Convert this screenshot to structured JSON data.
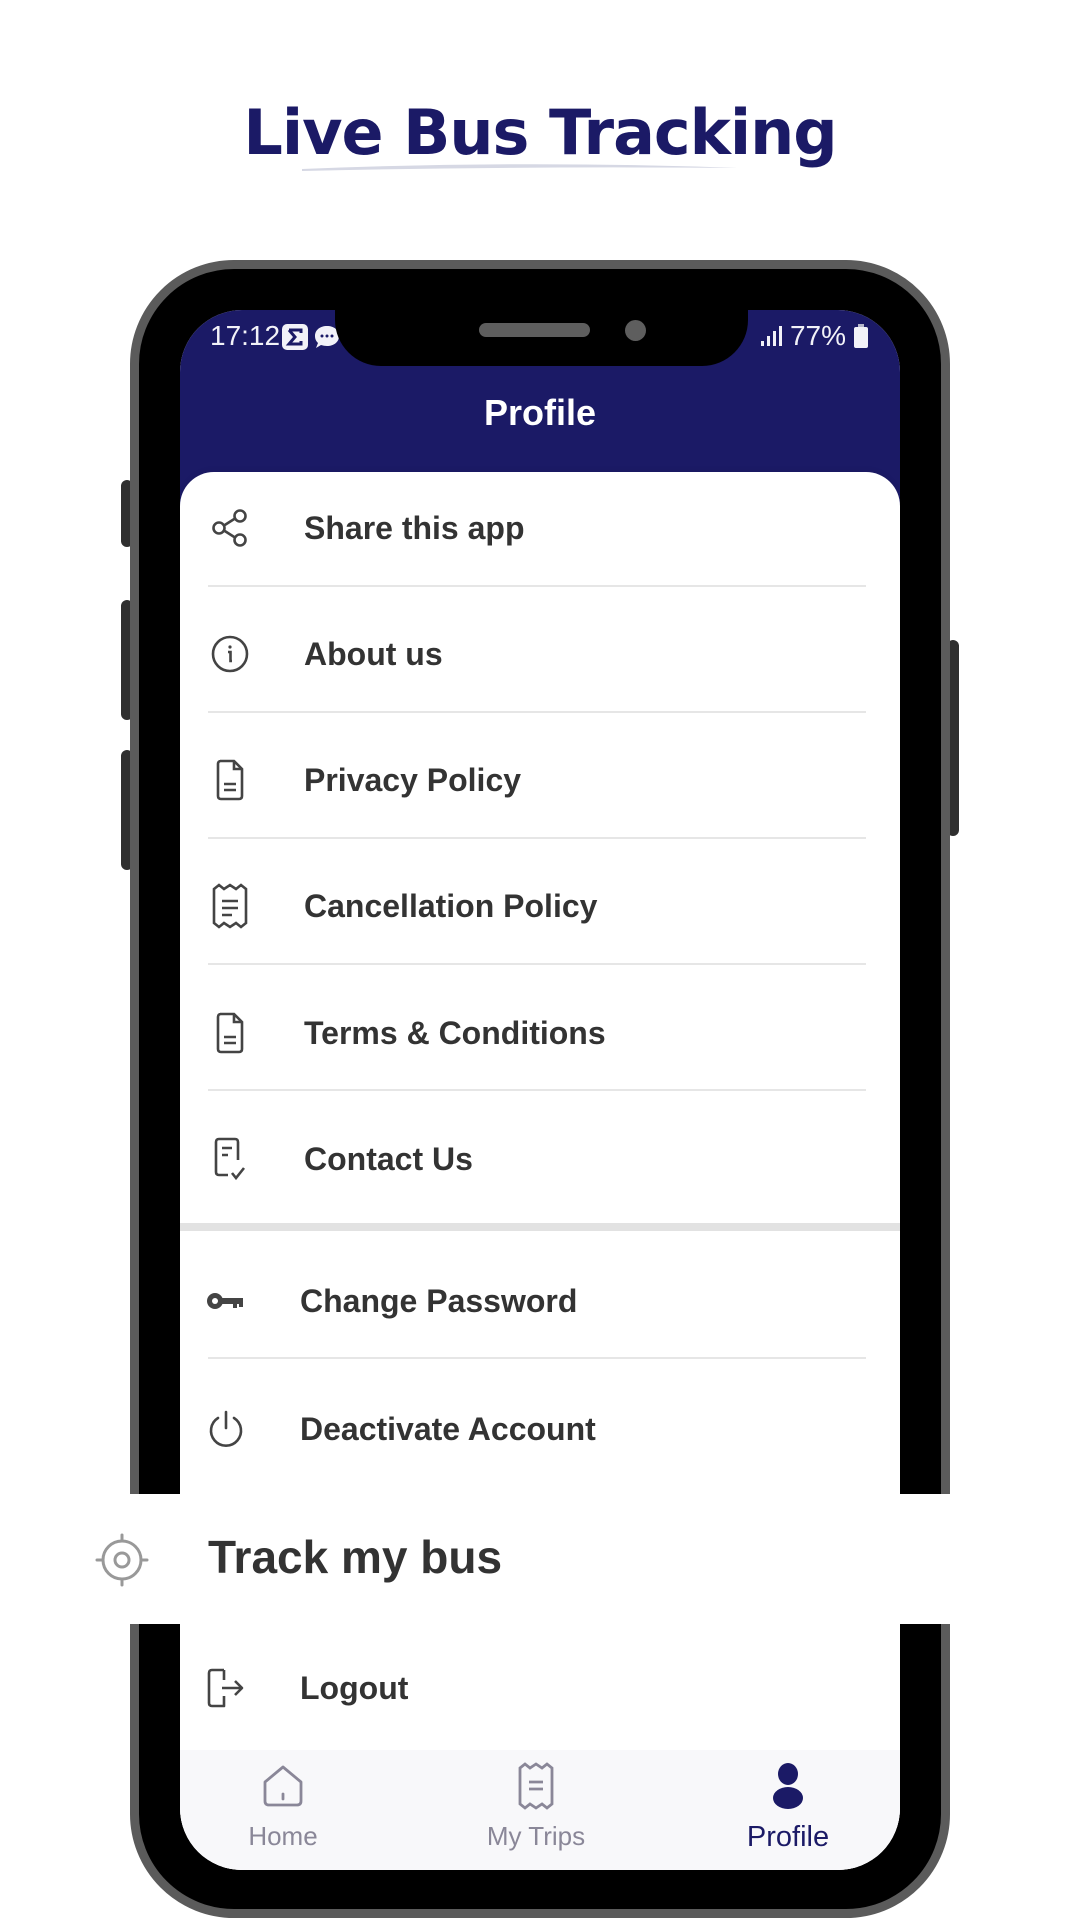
{
  "promo": {
    "title": "Live Bus Tracking"
  },
  "status_bar": {
    "time": "17:12",
    "battery": "77%"
  },
  "header": {
    "title": "Profile"
  },
  "menu": {
    "items": [
      {
        "label": "Share this app",
        "icon": "share-icon"
      },
      {
        "label": "About us",
        "icon": "info-icon"
      },
      {
        "label": "Privacy Policy",
        "icon": "document-icon"
      },
      {
        "label": "Cancellation Policy",
        "icon": "receipt-icon"
      },
      {
        "label": "Terms & Conditions",
        "icon": "document-icon"
      },
      {
        "label": "Contact Us",
        "icon": "contact-form-icon"
      }
    ],
    "account_items": [
      {
        "label": "Change Password",
        "icon": "key-icon"
      },
      {
        "label": "Deactivate Account",
        "icon": "power-icon"
      },
      {
        "label": "Logout",
        "icon": "logout-icon"
      }
    ]
  },
  "track_banner": {
    "label": "Track my bus",
    "icon": "location-target-icon"
  },
  "bottom_nav": {
    "items": [
      {
        "label": "Home",
        "icon": "home-icon",
        "active": false
      },
      {
        "label": "My Trips",
        "icon": "receipt-icon",
        "active": false
      },
      {
        "label": "Profile",
        "icon": "person-icon",
        "active": true
      }
    ]
  },
  "colors": {
    "brand": "#1b1a66",
    "text": "#333333",
    "inactive": "#8a8798"
  }
}
